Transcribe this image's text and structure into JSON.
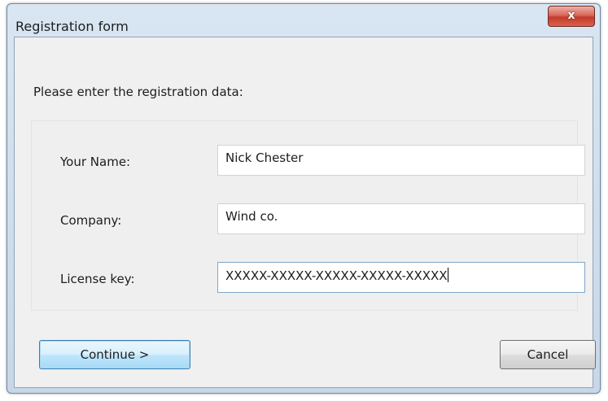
{
  "window": {
    "title": "Registration form",
    "close_label": "x"
  },
  "form": {
    "prompt": "Please enter the registration data:",
    "name_label": "Your Name:",
    "name_value": "Nick Chester",
    "company_label": "Company:",
    "company_value": "Wind co.",
    "license_label": "License key:",
    "license_value": "XXXXX-XXXXX-XXXXX-XXXXX-XXXXX"
  },
  "buttons": {
    "continue_label": "Continue >",
    "cancel_label": "Cancel"
  }
}
